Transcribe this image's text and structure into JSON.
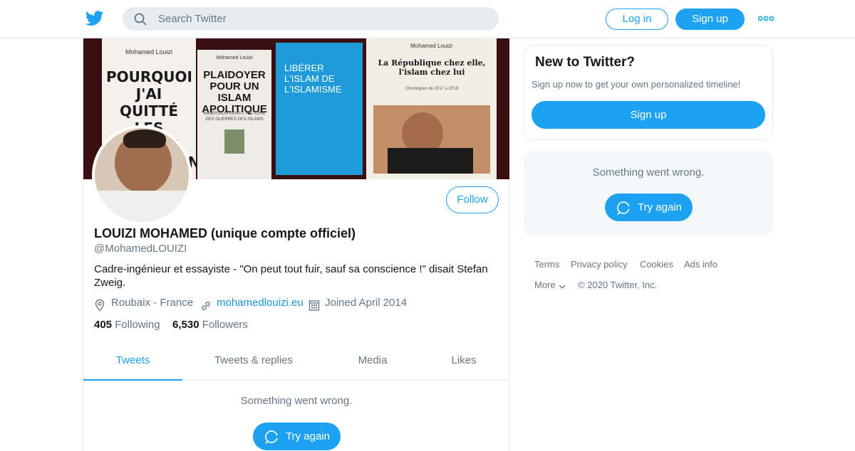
{
  "header": {
    "search_placeholder": "Search Twitter",
    "login_label": "Log in",
    "signup_label": "Sign up",
    "more_icon": "more-dots-icon",
    "brand_color": "#1da1f2"
  },
  "banner": {
    "books": [
      {
        "author": "Mohamed Louizi",
        "title": "POURQUOI J'AI QUITTÉ LES FRÈRES MUSULMANS"
      },
      {
        "author": "Mohamed Louizi",
        "title": "PLAIDOYER POUR UN ISLAM APOLITIQUE",
        "subtitle": "IMMERSION DANS L'HISTOIRE DES GUERRES DES ISLAMS"
      },
      {
        "author": "",
        "title": "LIBÉRER L'ISLAM DE L'ISLAMISME"
      },
      {
        "author": "Mohamed Louizi",
        "title": "La République chez elle, l'islam chez lui",
        "subtitle": "Chroniques de 2017 à 2019"
      }
    ]
  },
  "profile": {
    "follow_label": "Follow",
    "name": "LOUIZI MOHAMED (unique compte officiel)",
    "handle": "@MohamedLOUIZI",
    "bio": "Cadre-ingénieur et essayiste - \"On peut tout fuir, sauf sa conscience !\" disait Stefan Zweig.",
    "location": "Roubaix - France",
    "website": "mohamedlouizi.eu",
    "joined": "Joined April 2014",
    "following_count": "405",
    "following_label": "Following",
    "followers_count": "6,530",
    "followers_label": "Followers"
  },
  "tabs": [
    {
      "label": "Tweets",
      "active": true
    },
    {
      "label": "Tweets & replies",
      "active": false
    },
    {
      "label": "Media",
      "active": false
    },
    {
      "label": "Likes",
      "active": false
    }
  ],
  "timeline": {
    "error_text": "Something went wrong.",
    "retry_label": "Try again"
  },
  "sidebar": {
    "signup_card": {
      "title": "New to Twitter?",
      "subtitle": "Sign up now to get your own personalized timeline!",
      "button_label": "Sign up"
    },
    "error_box": {
      "error_text": "Something went wrong.",
      "retry_label": "Try again"
    },
    "footer": {
      "terms": "Terms",
      "privacy": "Privacy policy",
      "cookies": "Cookies",
      "ads_info": "Ads info",
      "more": "More",
      "copyright": "© 2020 Twitter, Inc."
    }
  }
}
